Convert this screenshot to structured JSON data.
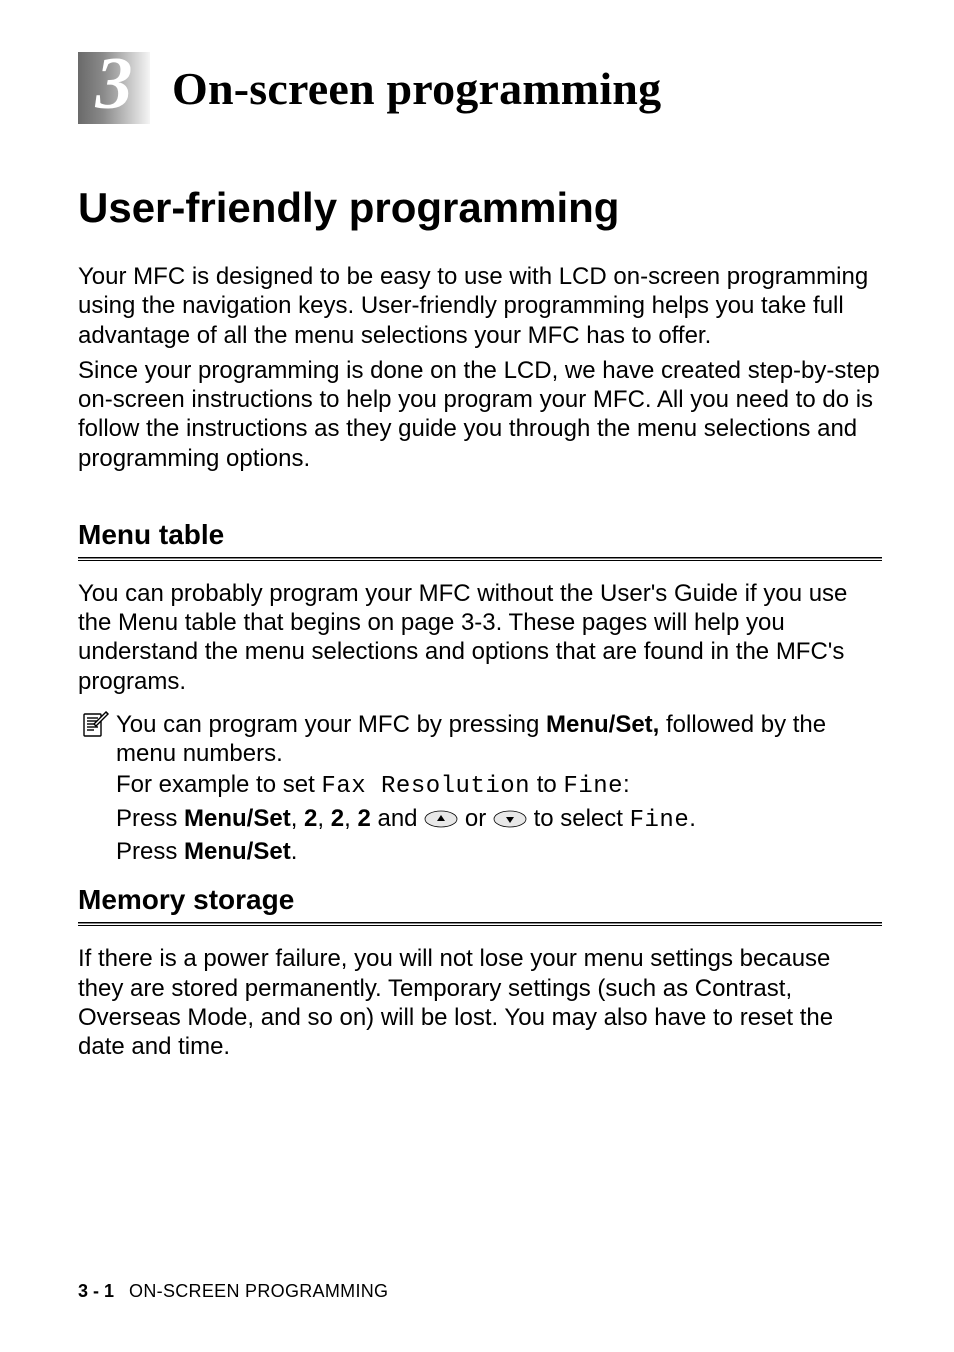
{
  "chapter": {
    "number": "3",
    "title": "On-screen programming"
  },
  "h1": "User-friendly programming",
  "intro_para1": "Your MFC is designed to be easy to use with LCD on-screen programming using the navigation keys. User-friendly programming helps you take full advantage of all the menu selections your MFC has to offer.",
  "intro_para2": "Since your programming is done on the LCD, we have created step-by-step on-screen instructions to help you program your MFC. All you need to do is follow the instructions as they guide you through the menu selections and programming options.",
  "section_menu": {
    "heading": "Menu table",
    "para": "You can probably program your MFC without the User's Guide if you use the Menu table that begins on page 3-3. These pages will help you understand the menu selections and options that are found in the MFC's programs.",
    "note": {
      "line1_pre": "You can program your MFC by pressing ",
      "line1_bold": "Menu/Set,",
      "line1_post": " followed by the menu numbers.",
      "line2_pre": "For example to set ",
      "line2_mono1": "Fax Resolution",
      "line2_mid": " to ",
      "line2_mono2": "Fine",
      "line2_post": ":",
      "line3_pre": "Press ",
      "line3_bold1": "Menu/Set",
      "line3_mid1": ", ",
      "line3_bold2": "2",
      "line3_mid2": ", ",
      "line3_bold3": "2",
      "line3_mid3": ", ",
      "line3_bold4": "2",
      "line3_mid4": " and ",
      "line3_or": " or ",
      "line3_mid5": " to select ",
      "line3_mono": "Fine",
      "line3_post": ".",
      "line4_pre": "Press ",
      "line4_bold": "Menu/Set",
      "line4_post": "."
    }
  },
  "section_memory": {
    "heading": "Memory storage",
    "para": "If there is a power failure, you will not lose your menu settings because they are stored permanently. Temporary settings (such as Contrast, Overseas Mode, and so on) will be lost. You may also have to reset the date and time."
  },
  "footer": {
    "page": "3 - 1",
    "section": "ON-SCREEN PROGRAMMING"
  }
}
